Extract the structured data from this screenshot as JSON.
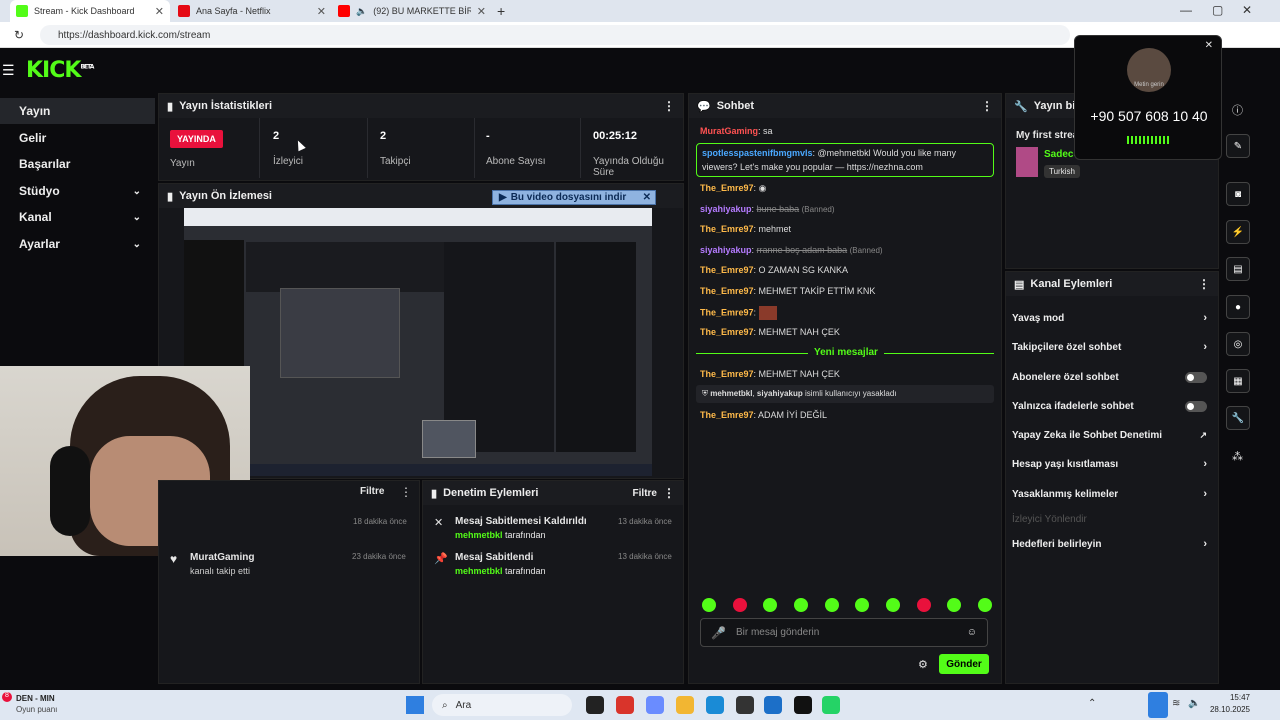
{
  "browser": {
    "tabs": [
      {
        "title": "Stream - Kick Dashboard",
        "color": "#53fc18"
      },
      {
        "title": "Ana Sayfa - Netflix",
        "color": "#e50914"
      },
      {
        "title": "(92) BU MARKETTE BİR ŞEYLE",
        "color": "#ff0000"
      }
    ],
    "url": "https://dashboard.kick.com/stream"
  },
  "brand": {
    "logo": "KICK",
    "beta": "BETA",
    "accent": "#53fc18"
  },
  "sidebar": {
    "items": [
      {
        "label": "Yayın"
      },
      {
        "label": "Gelir"
      },
      {
        "label": "Başarılar"
      },
      {
        "label": "Stüdyo"
      },
      {
        "label": "Kanal"
      },
      {
        "label": "Ayarlar"
      }
    ]
  },
  "stats": {
    "title": "Yayın İstatistikleri",
    "live_badge": "YAYINDA",
    "live_label": "Yayın",
    "items": [
      {
        "value": "2",
        "label": "İzleyici"
      },
      {
        "value": "2",
        "label": "Takipçi"
      },
      {
        "value": "-",
        "label": "Abone Sayısı"
      },
      {
        "value": "00:25:12",
        "label": "Yayında Olduğu Süre"
      }
    ]
  },
  "preview": {
    "title": "Yayın Ön İzlemesi",
    "download_label": "Bu video dosyasını indir"
  },
  "activity": {
    "filter": "Filtre",
    "items": [
      {
        "time": "18 dakika önce"
      },
      {
        "user": "MuratGaming",
        "text": "kanalı takip etti",
        "time": "23 dakika önce"
      }
    ]
  },
  "moderation": {
    "title": "Denetim Eylemleri",
    "filter": "Filtre",
    "items": [
      {
        "title": "Mesaj Sabitlemesi Kaldırıldı",
        "by_user": "mehmetbkl",
        "by_text": "tarafından",
        "time": "13 dakika önce"
      },
      {
        "title": "Mesaj Sabitlendi",
        "by_user": "mehmetbkl",
        "by_text": "tarafından",
        "time": "13 dakika önce"
      }
    ]
  },
  "chat": {
    "title": "Sohbet",
    "messages": [
      {
        "user": "MuratGaming",
        "text": ": sa"
      },
      {
        "user": "spotlesspastenifbmgmvls",
        "text": ": @mehmetbkl Would you like many",
        "text2": "viewers? Let's make you popular — https://nezhna.com"
      },
      {
        "user": "The_Emre97",
        "text": ":"
      },
      {
        "user": "siyahiyakup",
        "text": ":",
        "deleted": "bune baba",
        "tag": "(Banned)"
      },
      {
        "user": "The_Emre97",
        "text": ": mehmet"
      },
      {
        "user": "siyahiyakup",
        "text": ":",
        "deleted": "rranne boş adam baba",
        "tag": "(Banned)"
      },
      {
        "user": "The_Emre97",
        "text": ": O ZAMAN SG KANKA"
      },
      {
        "user": "The_Emre97",
        "text": ": MEHMET TAKİP ETTİM KNK"
      },
      {
        "user": "The_Emre97",
        "text": ":"
      },
      {
        "user": "The_Emre97",
        "text": ": MEHMET NAH ÇEK"
      },
      {
        "user": "The_Emre97",
        "text": ": MEHMET NAH ÇEK"
      },
      {
        "user": "The_Emre97",
        "text": ": ADAM İYİ DEĞİL"
      }
    ],
    "new_messages": "Yeni mesajlar",
    "ban_notice": {
      "mod": "mehmetbkl",
      "user": "siyahiyakup",
      "text": "isimli kullanıcıyı yasakladı"
    },
    "input_placeholder": "Bir mesaj gönderin",
    "send": "Gönder"
  },
  "stream_info": {
    "title": "Yayın bilgisi",
    "stream_title": "My first strea",
    "category": "Sadece",
    "language": "Turkish"
  },
  "channel_actions": {
    "title": "Kanal Eylemleri",
    "items": [
      {
        "label": "Yavaş mod",
        "kind": "arrow"
      },
      {
        "label": "Takipçilere özel sohbet",
        "kind": "arrow"
      },
      {
        "label": "Abonelere özel sohbet",
        "kind": "toggle"
      },
      {
        "label": "Yalnızca ifadelerle sohbet",
        "kind": "toggle"
      },
      {
        "label": "Yapay Zeka ile Sohbet Denetimi",
        "kind": "external"
      },
      {
        "label": "Hesap yaşı kısıtlaması",
        "kind": "arrow"
      },
      {
        "label": "Yasaklanmış kelimeler",
        "kind": "arrow"
      },
      {
        "label": "İzleyici Yönlendir",
        "kind": "disabled"
      },
      {
        "label": "Hedefleri belirleyin",
        "kind": "arrow"
      }
    ]
  },
  "call": {
    "caller": "Metin gerin",
    "number": "+90 507 608 10 40"
  },
  "taskbar": {
    "weather_title": "DEN - MIN",
    "weather_sub": "Oyun puanı",
    "weather_badge": "8",
    "search": "Ara",
    "time": "15:47",
    "date": "28.10.2025"
  }
}
